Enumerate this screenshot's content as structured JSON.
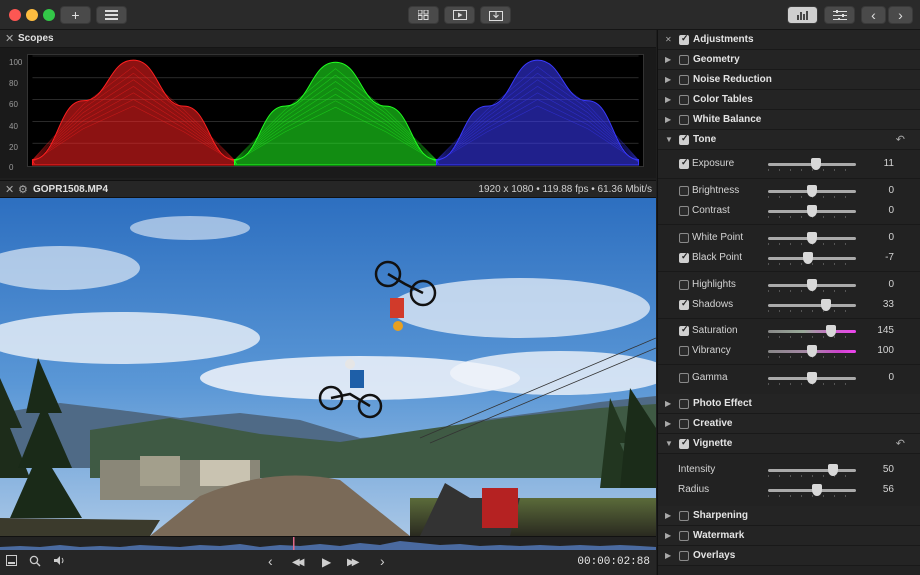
{
  "toolbar": {
    "traffic": {
      "close_color": "#fc5753",
      "minimize_color": "#fdbc40",
      "zoom_color": "#33c748"
    },
    "add_label": "+",
    "list_icon": "list-icon",
    "grid_icon": "grid-icon",
    "play_icon": "play-screen-icon",
    "export_icon": "export-icon",
    "scopes_icon": "histogram-icon",
    "adjust_icon": "sliders-icon",
    "back_label": "‹",
    "forward_label": "›"
  },
  "scopes": {
    "close": "✕",
    "title": "Scopes",
    "y_ticks": [
      "100",
      "80",
      "60",
      "40",
      "20",
      "0"
    ]
  },
  "chart_data": {
    "type": "area",
    "title": "",
    "xlabel": "",
    "ylabel": "",
    "ylim": [
      0,
      100
    ],
    "grid": true,
    "series": [
      {
        "color": "#ff2020",
        "x": [
          0,
          0.25,
          0.5,
          0.75,
          1
        ],
        "values": [
          5,
          60,
          98,
          55,
          5
        ]
      },
      {
        "color": "#20ff20",
        "x": [
          0,
          0.25,
          0.5,
          0.75,
          1
        ],
        "values": [
          5,
          55,
          96,
          55,
          5
        ]
      },
      {
        "color": "#3a3aff",
        "x": [
          0,
          0.25,
          0.5,
          0.75,
          1
        ],
        "values": [
          5,
          55,
          98,
          60,
          5
        ]
      }
    ]
  },
  "clip": {
    "close": "✕",
    "settings": "⚙",
    "name": "GOPR1508.MP4",
    "info": "1920 x 1080 • 119.88 fps • 61.36 Mbit/s"
  },
  "transport": {
    "timecode": "00:00:02:88",
    "prev_frame": "‹",
    "rewind": "◀◀",
    "play": "▶",
    "fast_forward": "▶▶",
    "next_frame": "›"
  },
  "adjustments": {
    "header": "Adjustments",
    "sections": {
      "geometry": "Geometry",
      "noise": "Noise Reduction",
      "color_tables": "Color Tables",
      "white_balance": "White Balance",
      "tone": "Tone",
      "photo_effect": "Photo Effect",
      "creative": "Creative",
      "vignette": "Vignette",
      "sharpening": "Sharpening",
      "watermark": "Watermark",
      "overlays": "Overlays"
    },
    "reset_glyph": "↶",
    "tone": {
      "exposure": {
        "label": "Exposure",
        "value": "11",
        "pos": 0.55
      },
      "brightness": {
        "label": "Brightness",
        "value": "0",
        "pos": 0.5
      },
      "contrast": {
        "label": "Contrast",
        "value": "0",
        "pos": 0.5
      },
      "white_point": {
        "label": "White Point",
        "value": "0",
        "pos": 0.5
      },
      "black_point": {
        "label": "Black Point",
        "value": "-7",
        "pos": 0.46
      },
      "highlights": {
        "label": "Highlights",
        "value": "0",
        "pos": 0.5
      },
      "shadows": {
        "label": "Shadows",
        "value": "33",
        "pos": 0.66
      },
      "saturation": {
        "label": "Saturation",
        "value": "145",
        "pos": 0.72
      },
      "vibrancy": {
        "label": "Vibrancy",
        "value": "100",
        "pos": 0.5
      },
      "gamma": {
        "label": "Gamma",
        "value": "0",
        "pos": 0.5
      }
    },
    "vignette": {
      "intensity": {
        "label": "Intensity",
        "value": "50",
        "pos": 0.74
      },
      "radius": {
        "label": "Radius",
        "value": "56",
        "pos": 0.56
      }
    }
  }
}
